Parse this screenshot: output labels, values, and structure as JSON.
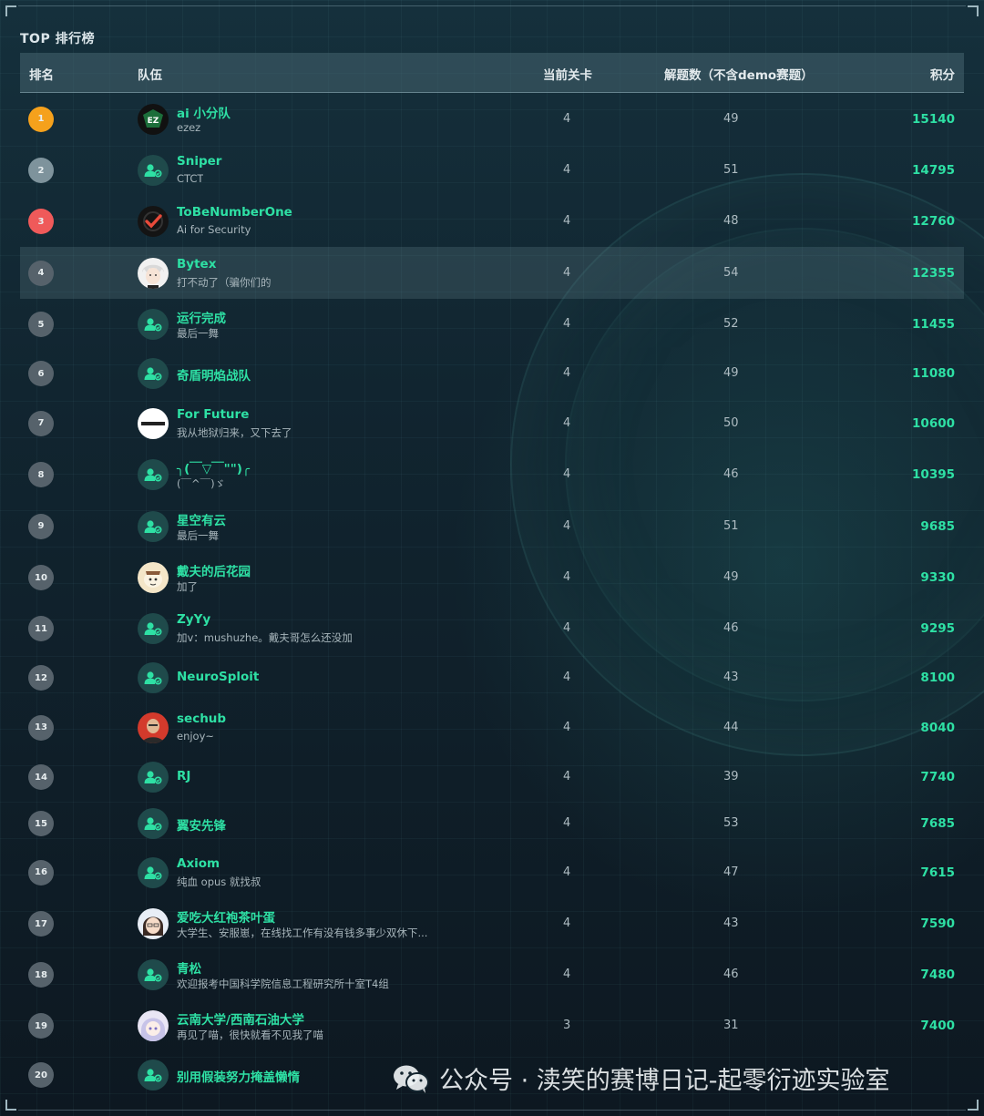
{
  "title": "TOP 排行榜",
  "headers": {
    "rank": "排名",
    "team": "队伍",
    "level": "当前关卡",
    "solved": "解题数（不含demo赛题）",
    "score": "积分"
  },
  "colors": {
    "accent": "#2ee0a4",
    "gold": "#f5a11c",
    "silver": "#7e939c",
    "bronze": "#ef5a5a"
  },
  "rows": [
    {
      "rank": "1",
      "name": "ai 小分队",
      "sub": "ezez",
      "level": "4",
      "solved": "49",
      "score": "15140",
      "avatar": "ez-logo-icon"
    },
    {
      "rank": "2",
      "name": "Sniper",
      "sub": "CTCT",
      "level": "4",
      "solved": "51",
      "score": "14795",
      "avatar": "default-team-icon"
    },
    {
      "rank": "3",
      "name": "ToBeNumberOne",
      "sub": "Ai for Security",
      "level": "4",
      "solved": "48",
      "score": "12760",
      "avatar": "checkmark-logo-icon"
    },
    {
      "rank": "4",
      "name": "Bytex",
      "sub": "打不动了（骗你们的",
      "level": "4",
      "solved": "54",
      "score": "12355",
      "avatar": "anime-avatar-icon"
    },
    {
      "rank": "5",
      "name": "运行完成",
      "sub": "最后一舞",
      "level": "4",
      "solved": "52",
      "score": "11455",
      "avatar": "default-team-icon"
    },
    {
      "rank": "6",
      "name": "奇盾明焰战队",
      "sub": "",
      "level": "4",
      "solved": "49",
      "score": "11080",
      "avatar": "default-team-icon"
    },
    {
      "rank": "7",
      "name": "For Future",
      "sub": "我从地狱归来，又下去了",
      "level": "4",
      "solved": "50",
      "score": "10600",
      "avatar": "white-logo-icon"
    },
    {
      "rank": "8",
      "name": "╮(￣▽￣\"\")╭",
      "sub": "(￣^￣)ゞ",
      "level": "4",
      "solved": "46",
      "score": "10395",
      "avatar": "default-team-icon"
    },
    {
      "rank": "9",
      "name": "星空有云",
      "sub": "最后一舞",
      "level": "4",
      "solved": "51",
      "score": "9685",
      "avatar": "default-team-icon"
    },
    {
      "rank": "10",
      "name": "戴夫的后花园",
      "sub": "加了",
      "level": "4",
      "solved": "49",
      "score": "9330",
      "avatar": "cartoon-avatar-icon"
    },
    {
      "rank": "11",
      "name": "ZyYy",
      "sub": "加v：mushuzhe。戴夫哥怎么还没加",
      "level": "4",
      "solved": "46",
      "score": "9295",
      "avatar": "default-team-icon"
    },
    {
      "rank": "12",
      "name": "NeuroSploit",
      "sub": "",
      "level": "4",
      "solved": "43",
      "score": "8100",
      "avatar": "default-team-icon"
    },
    {
      "rank": "13",
      "name": "sechub",
      "sub": "enjoy~",
      "level": "4",
      "solved": "44",
      "score": "8040",
      "avatar": "photo-avatar-icon"
    },
    {
      "rank": "14",
      "name": "RJ",
      "sub": "",
      "level": "4",
      "solved": "39",
      "score": "7740",
      "avatar": "default-team-icon"
    },
    {
      "rank": "15",
      "name": "翼安先锋",
      "sub": "",
      "level": "4",
      "solved": "53",
      "score": "7685",
      "avatar": "default-team-icon"
    },
    {
      "rank": "16",
      "name": "Axiom",
      "sub": "纯血 opus 就找叔",
      "level": "4",
      "solved": "47",
      "score": "7615",
      "avatar": "default-team-icon"
    },
    {
      "rank": "17",
      "name": "爱吃大红袍茶叶蛋",
      "sub": "大学生、安服崽，在线找工作有没有钱多事少双休下...",
      "level": "4",
      "solved": "43",
      "score": "7590",
      "avatar": "girl-avatar-icon"
    },
    {
      "rank": "18",
      "name": "青松",
      "sub": "欢迎报考中国科学院信息工程研究所十室T4组",
      "level": "4",
      "solved": "46",
      "score": "7480",
      "avatar": "default-team-icon"
    },
    {
      "rank": "19",
      "name": "云南大学/西南石油大学",
      "sub": "再见了喵，很快就看不见我了喵",
      "level": "3",
      "solved": "31",
      "score": "7400",
      "avatar": "anime-girl-avatar-icon"
    },
    {
      "rank": "20",
      "name": "别用假装努力掩盖懒惰",
      "sub": "",
      "level": "",
      "solved": "",
      "score": "",
      "avatar": "default-team-icon"
    }
  ],
  "watermark": "公众号 · 渎笑的赛博日记-起零衍迹实验室"
}
